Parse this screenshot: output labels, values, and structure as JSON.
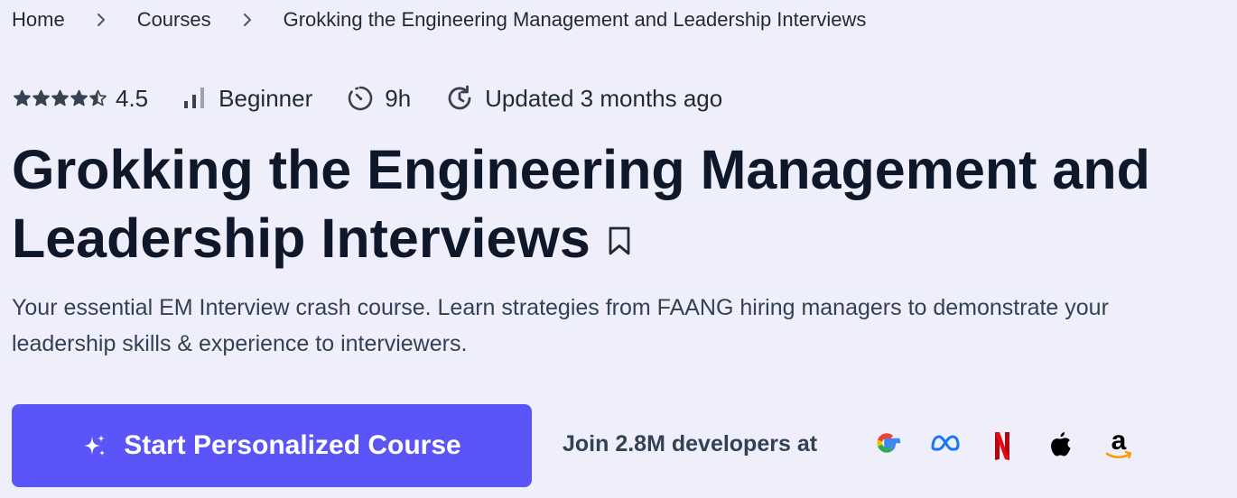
{
  "breadcrumb": {
    "items": [
      "Home",
      "Courses",
      "Grokking the Engineering Management and Leadership Interviews"
    ]
  },
  "meta": {
    "rating": "4.5",
    "rating_stars": 4.5,
    "level": "Beginner",
    "duration": "9h",
    "updated": "Updated 3 months ago"
  },
  "course": {
    "title": "Grokking the Engineering Management and Leadership Interviews",
    "subtitle": "Your essential EM Interview crash course. Learn strategies from FAANG hiring managers to demonstrate your leadership skills & experience to interviewers."
  },
  "cta": {
    "label": "Start Personalized Course"
  },
  "social_proof": {
    "text": "Join 2.8M developers at",
    "companies": [
      "google-logo",
      "meta-logo",
      "netflix-logo",
      "apple-logo",
      "amazon-logo"
    ]
  },
  "colors": {
    "background": "#efeffc",
    "primary_button": "#5a54f9",
    "title_text": "#0f172a",
    "body_text": "#334155"
  }
}
